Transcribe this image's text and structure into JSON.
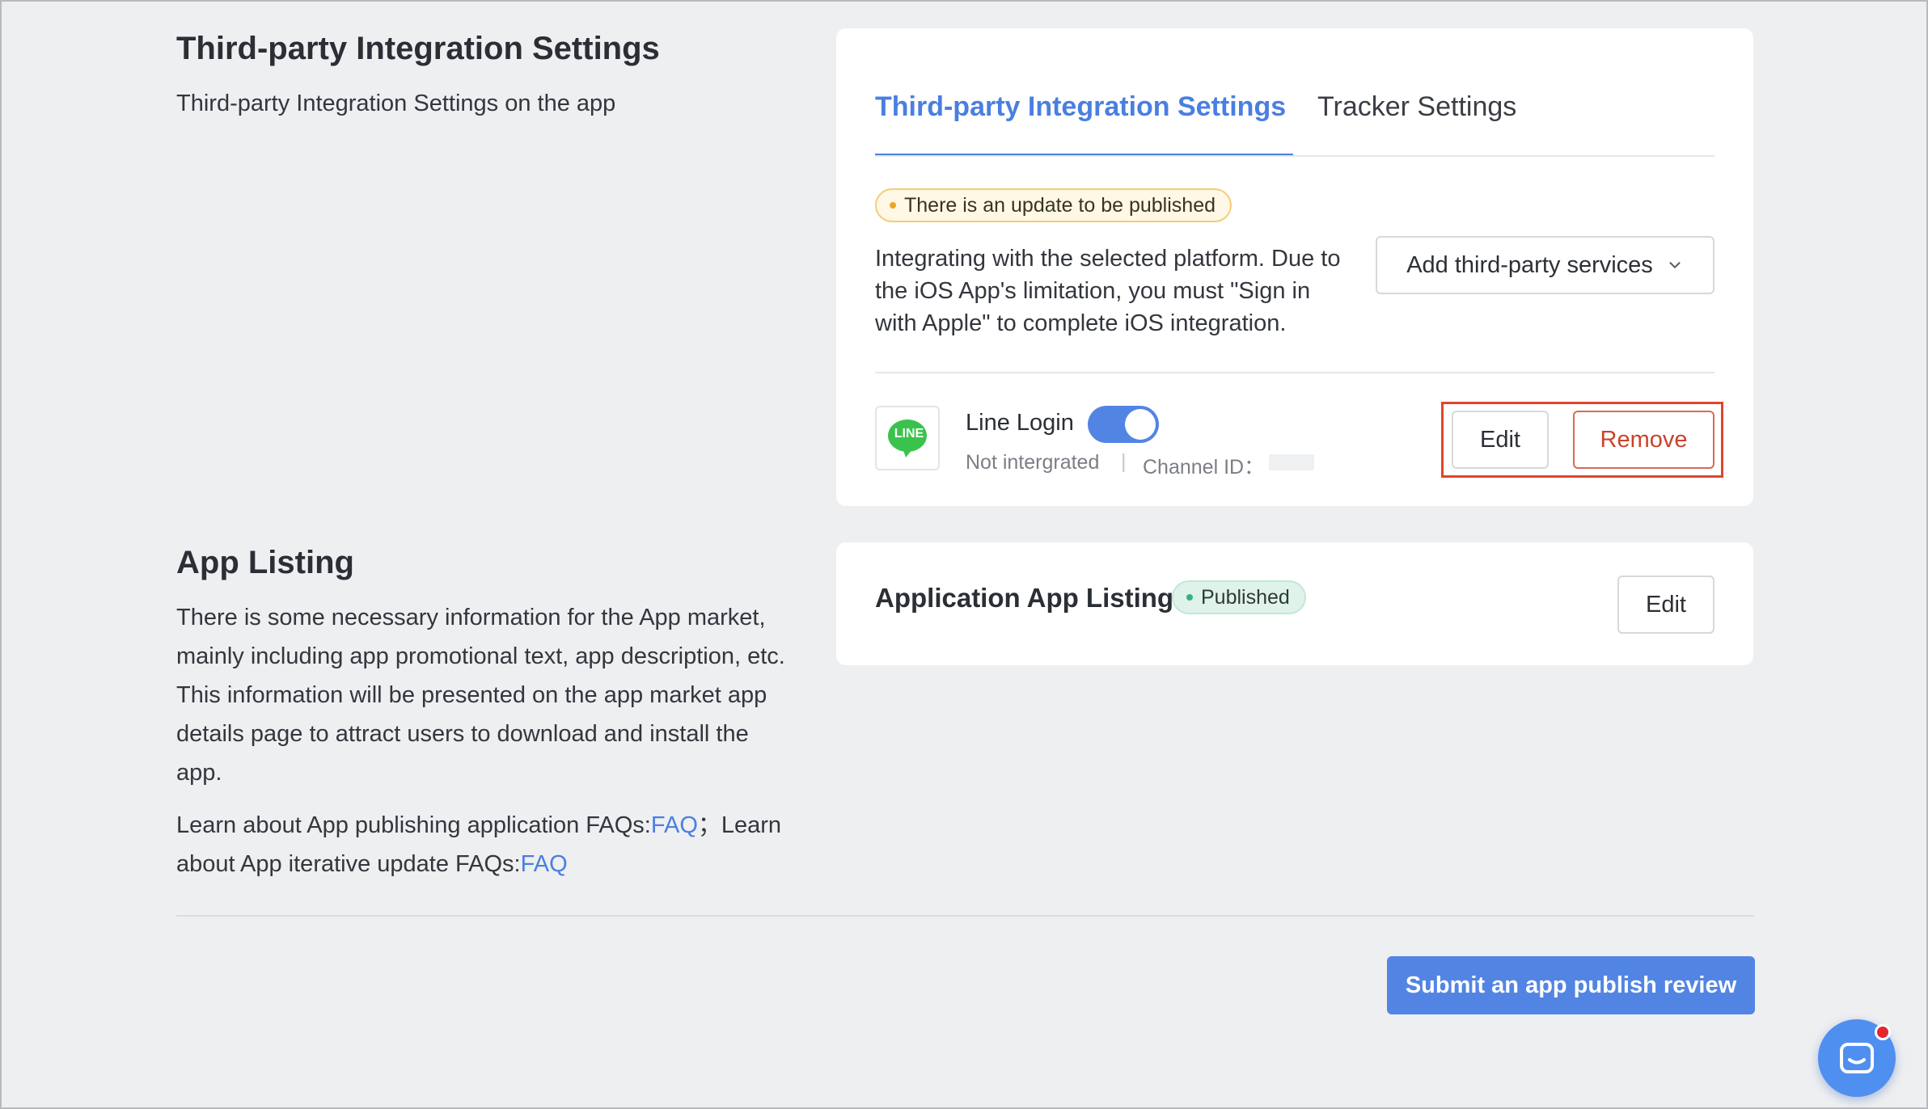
{
  "third_party": {
    "title": "Third-party Integration Settings",
    "description": "Third-party Integration Settings on the app",
    "tabs": [
      {
        "label": "Third-party Integration Settings",
        "active": true
      },
      {
        "label": "Tracker Settings",
        "active": false
      }
    ],
    "update_badge": "There is an update to be published",
    "info_lines": [
      "Integrating with the selected platform. Due to",
      "the iOS App's limitation, you must \"Sign in",
      "with Apple\" to complete iOS integration."
    ],
    "add_services_label": "Add third-party services",
    "integration": {
      "logo_text": "LINE",
      "name": "Line Login",
      "enabled": true,
      "status": "Not intergrated",
      "separator": "|",
      "channel_label": "Channel ID：",
      "edit_label": "Edit",
      "remove_label": "Remove"
    }
  },
  "app_listing": {
    "title": "App Listing",
    "description_lines": [
      "There is some necessary information for the App market,",
      "mainly including app promotional text, app description, etc.",
      "This information will be presented on the app market app",
      "details page to attract users to download and install the",
      "app."
    ],
    "faq_line1_prefix": "Learn about App publishing application FAQs:",
    "faq_link1": "FAQ",
    "faq_line1_suffix": "；Learn",
    "faq_line2_prefix": "about App iterative update FAQs:",
    "faq_link2": "FAQ",
    "card_title": "Application App Listing",
    "status_badge": "Published",
    "edit_label": "Edit"
  },
  "footer": {
    "submit_label": "Submit an app publish review"
  },
  "colors": {
    "accent": "#4a7fe0",
    "primary_button": "#5285e3",
    "danger": "#c9432b",
    "highlight": "#e0452e",
    "warning": "#f0a623",
    "success": "#37b27a",
    "line_green": "#3ac34c"
  }
}
